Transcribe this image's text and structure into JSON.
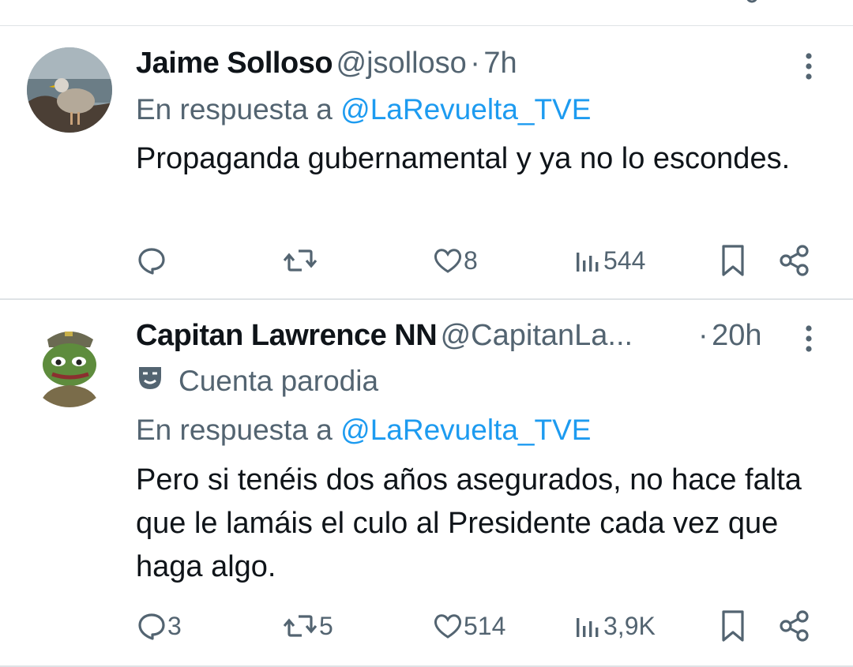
{
  "colors": {
    "accent": "#1d9bf0",
    "muted": "#536471",
    "text": "#0f1419",
    "divider": "#dfe3e6"
  },
  "tweets": [
    {
      "name": "Jaime Solloso",
      "handle": "@jsolloso",
      "dot": "·",
      "time": "7h",
      "reply_prefix": "En respuesta a",
      "reply_to": "@LaRevuelta_TVE",
      "text": "Propaganda gubernamental y ya no lo escondes.",
      "actions": {
        "replies": "",
        "retweets": "",
        "likes": "8",
        "views": "544"
      },
      "icons": [
        "reply-icon",
        "retweet-icon",
        "like-icon",
        "views-icon",
        "bookmark-icon",
        "share-icon",
        "more-icon"
      ]
    },
    {
      "name": "Capitan Lawrence NN",
      "handle": "@CapitanLa...",
      "dot": "·",
      "time": "20h",
      "badge": "Cuenta parodia",
      "reply_prefix": "En respuesta a",
      "reply_to": "@LaRevuelta_TVE",
      "text": "Pero si tenéis dos años asegurados, no hace falta que le lamáis el culo al Presidente cada vez que haga algo.",
      "actions": {
        "replies": "3",
        "retweets": "5",
        "likes": "514",
        "views": "3,9K"
      },
      "icons": [
        "reply-icon",
        "retweet-icon",
        "like-icon",
        "views-icon",
        "bookmark-icon",
        "share-icon",
        "more-icon",
        "parody-mask-icon"
      ]
    }
  ]
}
